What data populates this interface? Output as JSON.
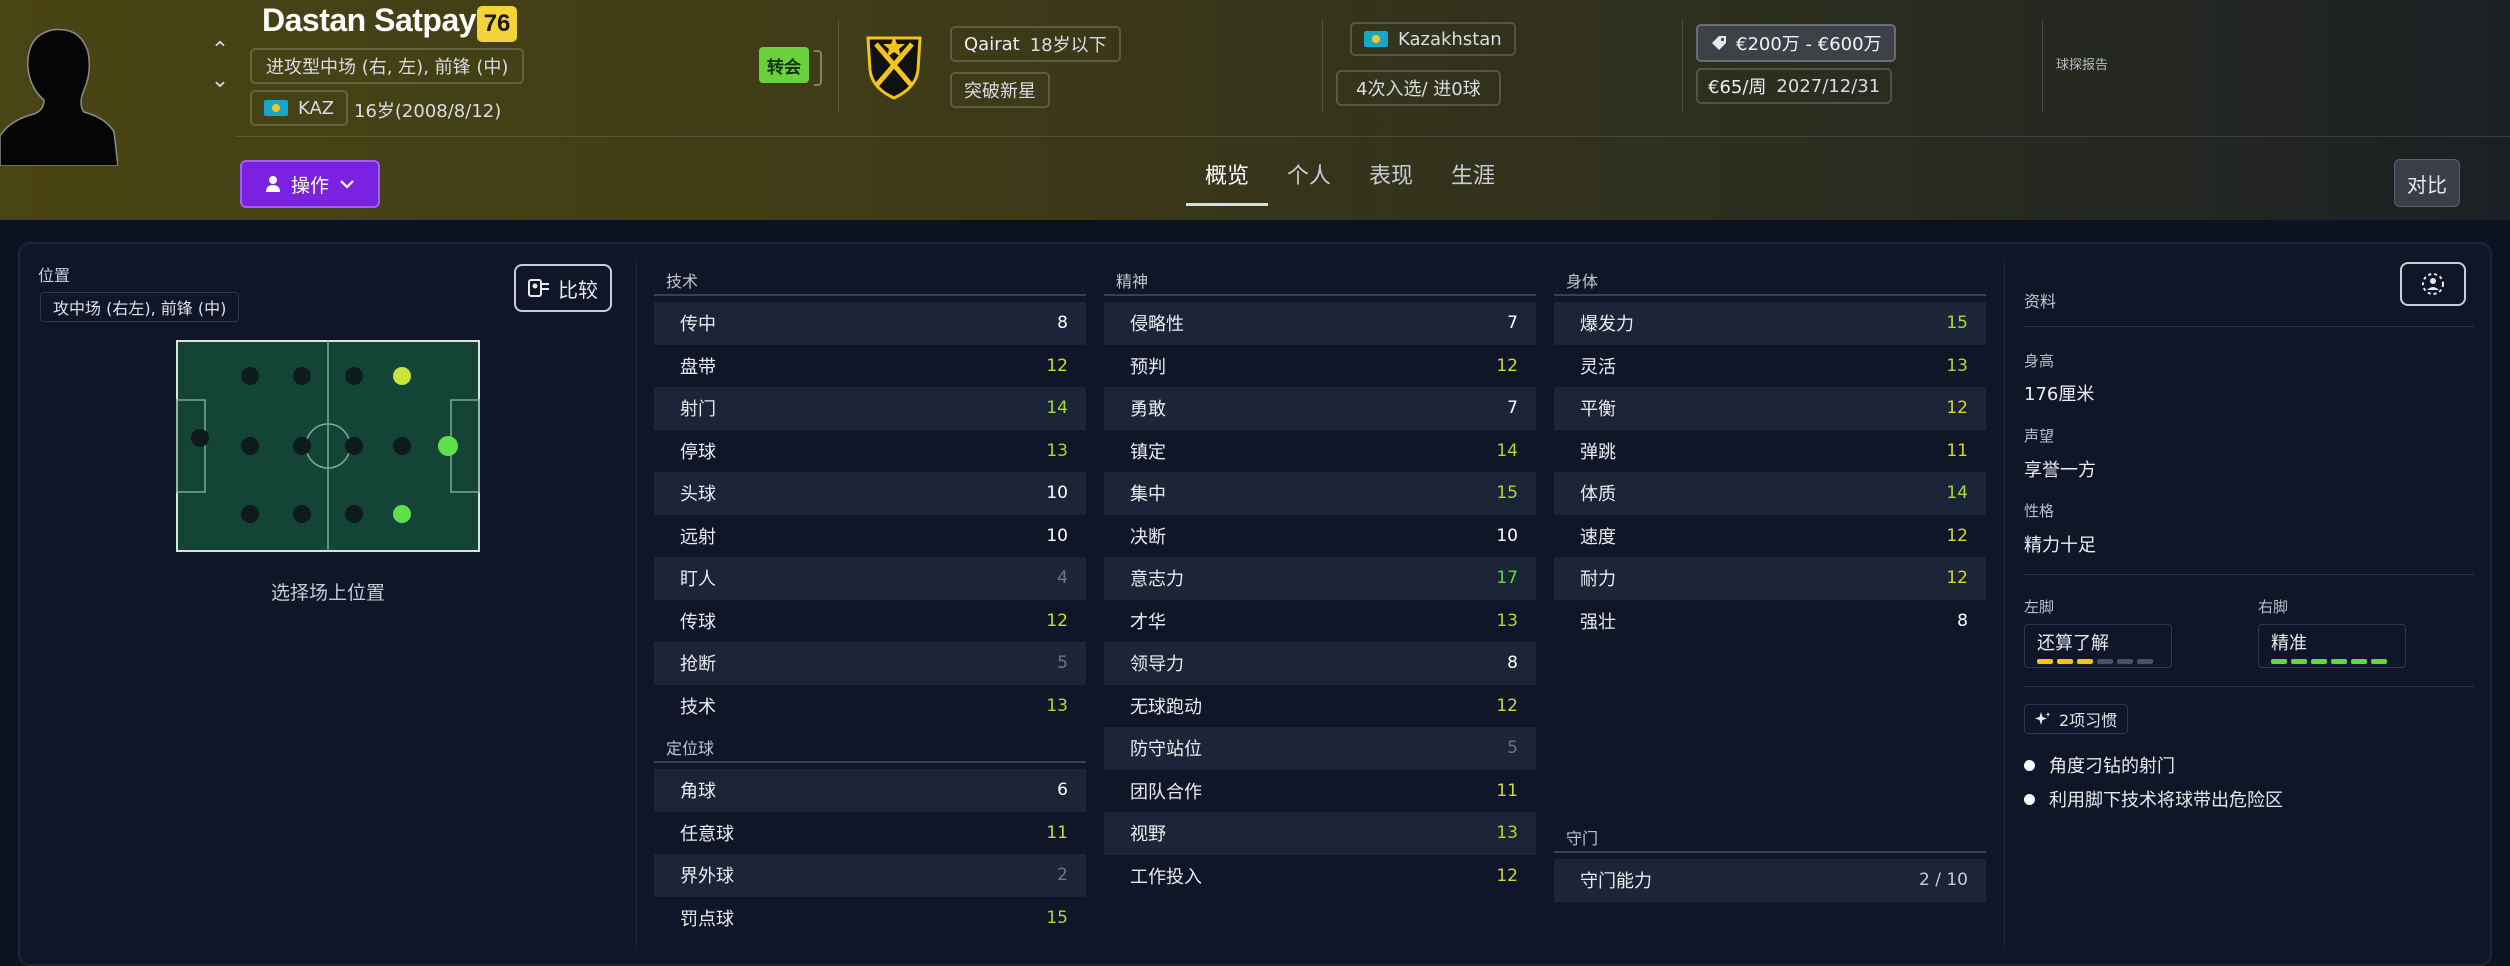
{
  "player": {
    "name": "Dastan Satpayev",
    "rating": "76",
    "positions": "进攻型中场 (右, 左), 前锋 (中)",
    "nation_code": "KAZ",
    "age_dob": "16岁(2008/8/12)",
    "transfer_badge": "转会"
  },
  "club": {
    "name": "Qairat",
    "team": "18岁以下",
    "tag": "突破新星"
  },
  "nation": {
    "name": "Kazakhstan",
    "caps": "4次入选/ 进0球"
  },
  "contract": {
    "value": "€200万 - €600万",
    "wage": "€65/周",
    "expiry": "2027/12/31"
  },
  "scout_report_label": "球探报告",
  "actions": {
    "label": "操作"
  },
  "tabs": [
    "概览",
    "个人",
    "表现",
    "生涯"
  ],
  "compare_label": "对比",
  "position_panel": {
    "title": "位置",
    "chip": "攻中场 (右左), 前锋 (中)",
    "compare_button": "比较",
    "select_text": "选择场上位置",
    "pitch_colors": {
      "grass": "#134436",
      "line": "#7fa89a",
      "empty": "#0d1b1b",
      "natural": "#5fe04a",
      "accomplished": "#c9e33a"
    }
  },
  "attributes": {
    "technical": {
      "title": "技术",
      "items": [
        {
          "name": "传中",
          "value": "8",
          "tier": "white"
        },
        {
          "name": "盘带",
          "value": "12",
          "tier": "yellow"
        },
        {
          "name": "射门",
          "value": "14",
          "tier": "lime"
        },
        {
          "name": "停球",
          "value": "13",
          "tier": "lime"
        },
        {
          "name": "头球",
          "value": "10",
          "tier": "white"
        },
        {
          "name": "远射",
          "value": "10",
          "tier": "white"
        },
        {
          "name": "盯人",
          "value": "4",
          "tier": "grey"
        },
        {
          "name": "传球",
          "value": "12",
          "tier": "yellow"
        },
        {
          "name": "抢断",
          "value": "5",
          "tier": "grey"
        },
        {
          "name": "技术",
          "value": "13",
          "tier": "lime"
        }
      ]
    },
    "set_pieces": {
      "title": "定位球",
      "items": [
        {
          "name": "角球",
          "value": "6",
          "tier": "white"
        },
        {
          "name": "任意球",
          "value": "11",
          "tier": "yellow"
        },
        {
          "name": "界外球",
          "value": "2",
          "tier": "grey"
        },
        {
          "name": "罚点球",
          "value": "15",
          "tier": "lime"
        }
      ]
    },
    "mental": {
      "title": "精神",
      "items": [
        {
          "name": "侵略性",
          "value": "7",
          "tier": "white"
        },
        {
          "name": "预判",
          "value": "12",
          "tier": "yellow"
        },
        {
          "name": "勇敢",
          "value": "7",
          "tier": "white"
        },
        {
          "name": "镇定",
          "value": "14",
          "tier": "lime"
        },
        {
          "name": "集中",
          "value": "15",
          "tier": "lime"
        },
        {
          "name": "决断",
          "value": "10",
          "tier": "white"
        },
        {
          "name": "意志力",
          "value": "17",
          "tier": "green"
        },
        {
          "name": "才华",
          "value": "13",
          "tier": "lime"
        },
        {
          "name": "领导力",
          "value": "8",
          "tier": "white"
        },
        {
          "name": "无球跑动",
          "value": "12",
          "tier": "yellow"
        },
        {
          "name": "防守站位",
          "value": "5",
          "tier": "grey"
        },
        {
          "name": "团队合作",
          "value": "11",
          "tier": "yellow"
        },
        {
          "name": "视野",
          "value": "13",
          "tier": "lime"
        },
        {
          "name": "工作投入",
          "value": "12",
          "tier": "yellow"
        }
      ]
    },
    "physical": {
      "title": "身体",
      "items": [
        {
          "name": "爆发力",
          "value": "15",
          "tier": "lime"
        },
        {
          "name": "灵活",
          "value": "13",
          "tier": "lime"
        },
        {
          "name": "平衡",
          "value": "12",
          "tier": "yellow"
        },
        {
          "name": "弹跳",
          "value": "11",
          "tier": "yellow"
        },
        {
          "name": "体质",
          "value": "14",
          "tier": "lime"
        },
        {
          "name": "速度",
          "value": "12",
          "tier": "yellow"
        },
        {
          "name": "耐力",
          "value": "12",
          "tier": "yellow"
        },
        {
          "name": "强壮",
          "value": "8",
          "tier": "white"
        }
      ]
    },
    "goalkeeping": {
      "title": "守门",
      "items": [
        {
          "name": "守门能力",
          "value": "2 / 10",
          "tier": "grey-light"
        }
      ]
    }
  },
  "tier_colors": {
    "white": "#ffffff",
    "grey": "#6e7685",
    "yellow": "#d3d72f",
    "lime": "#a6dc32",
    "green": "#5fd94a"
  },
  "info": {
    "title": "资料",
    "height_label": "身高",
    "height": "176厘米",
    "reputation_label": "声望",
    "reputation": "享誉一方",
    "personality_label": "性格",
    "personality": "精力十足",
    "left_foot_label": "左脚",
    "left_foot": "还算了解",
    "left_foot_level": 3,
    "right_foot_label": "右脚",
    "right_foot": "精准",
    "right_foot_level": 6,
    "foot_scale_max": 6,
    "habits_chip": "2项习惯",
    "habits": [
      "角度刁钻的射门",
      "利用脚下技术将球带出危险区"
    ]
  }
}
